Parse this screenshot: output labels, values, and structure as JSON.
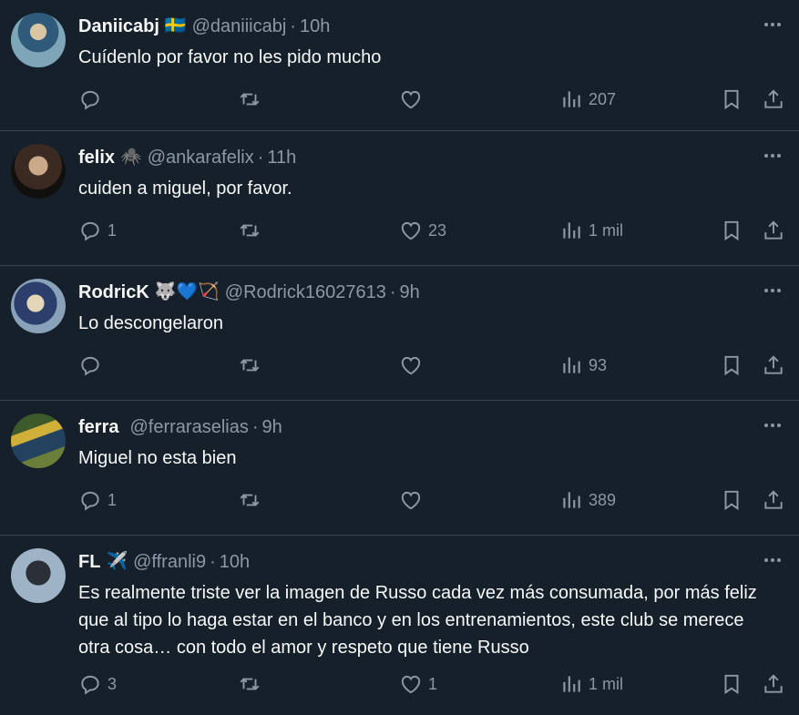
{
  "tweets": [
    {
      "name": "Daniicabj",
      "badge": "🇸🇪",
      "handle": "@daniiicabj",
      "time": "10h",
      "text": "Cuídenlo por favor no les pido mucho",
      "replies": "",
      "retweets": "",
      "likes": "",
      "views": "207"
    },
    {
      "name": "felix",
      "badge": "🕷️",
      "handle": "@ankarafelix",
      "time": "11h",
      "text": "cuiden a miguel, por favor.",
      "replies": "1",
      "retweets": "",
      "likes": "23",
      "views": "1 mil"
    },
    {
      "name": "RodricK",
      "badge": "🐺💙🏹",
      "handle": "@Rodrick16027613",
      "time": "9h",
      "text": "Lo descongelaron",
      "replies": "",
      "retweets": "",
      "likes": "",
      "views": "93"
    },
    {
      "name": "ferra",
      "badge": "",
      "handle": "@ferraraselias",
      "time": "9h",
      "text": "Miguel no esta bien",
      "replies": "1",
      "retweets": "",
      "likes": "",
      "views": "389"
    },
    {
      "name": "FL",
      "badge": "✈️",
      "handle": "@ffranli9",
      "time": "10h",
      "text": "Es realmente triste ver la imagen de Russo cada vez más consumada, por más feliz que al tipo lo haga estar en el banco y en los entrenamientos, este club se merece otra cosa… con todo el amor y respeto que tiene Russo",
      "replies": "3",
      "retweets": "",
      "likes": "1",
      "views": "1 mil"
    }
  ],
  "separator": "·",
  "icons": {
    "reply": "reply-icon",
    "retweet": "retweet-icon",
    "like": "like-icon",
    "views": "views-icon",
    "bookmark": "bookmark-icon",
    "share": "share-icon",
    "more": "more-icon"
  },
  "colors": {
    "background": "#15202b",
    "text": "#f7f9f9",
    "muted": "#8b98a5",
    "divider": "#38444d"
  }
}
